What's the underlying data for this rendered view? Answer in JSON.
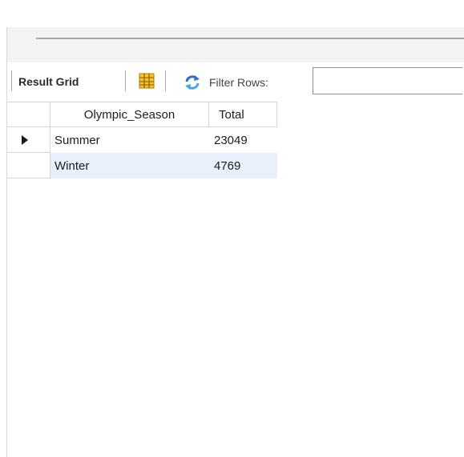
{
  "toolbar": {
    "result_grid_label": "Result Grid",
    "grid_icon": "form-grid-icon",
    "refresh_icon": "refresh-icon",
    "filter_label": "Filter Rows:",
    "filter_value": "",
    "filter_placeholder": ""
  },
  "grid": {
    "columns": [
      "Olympic_Season",
      "Total"
    ],
    "rows": [
      {
        "Olympic_Season": "Summer",
        "Total": "23049",
        "current": true
      },
      {
        "Olympic_Season": "Winter",
        "Total": "4769",
        "current": false
      }
    ],
    "indicator_icon": "row-pointer-icon"
  },
  "colors": {
    "alt_row": "#e7f0fb",
    "grid_line": "#d4d4d4",
    "band": "#f3f3f3"
  }
}
